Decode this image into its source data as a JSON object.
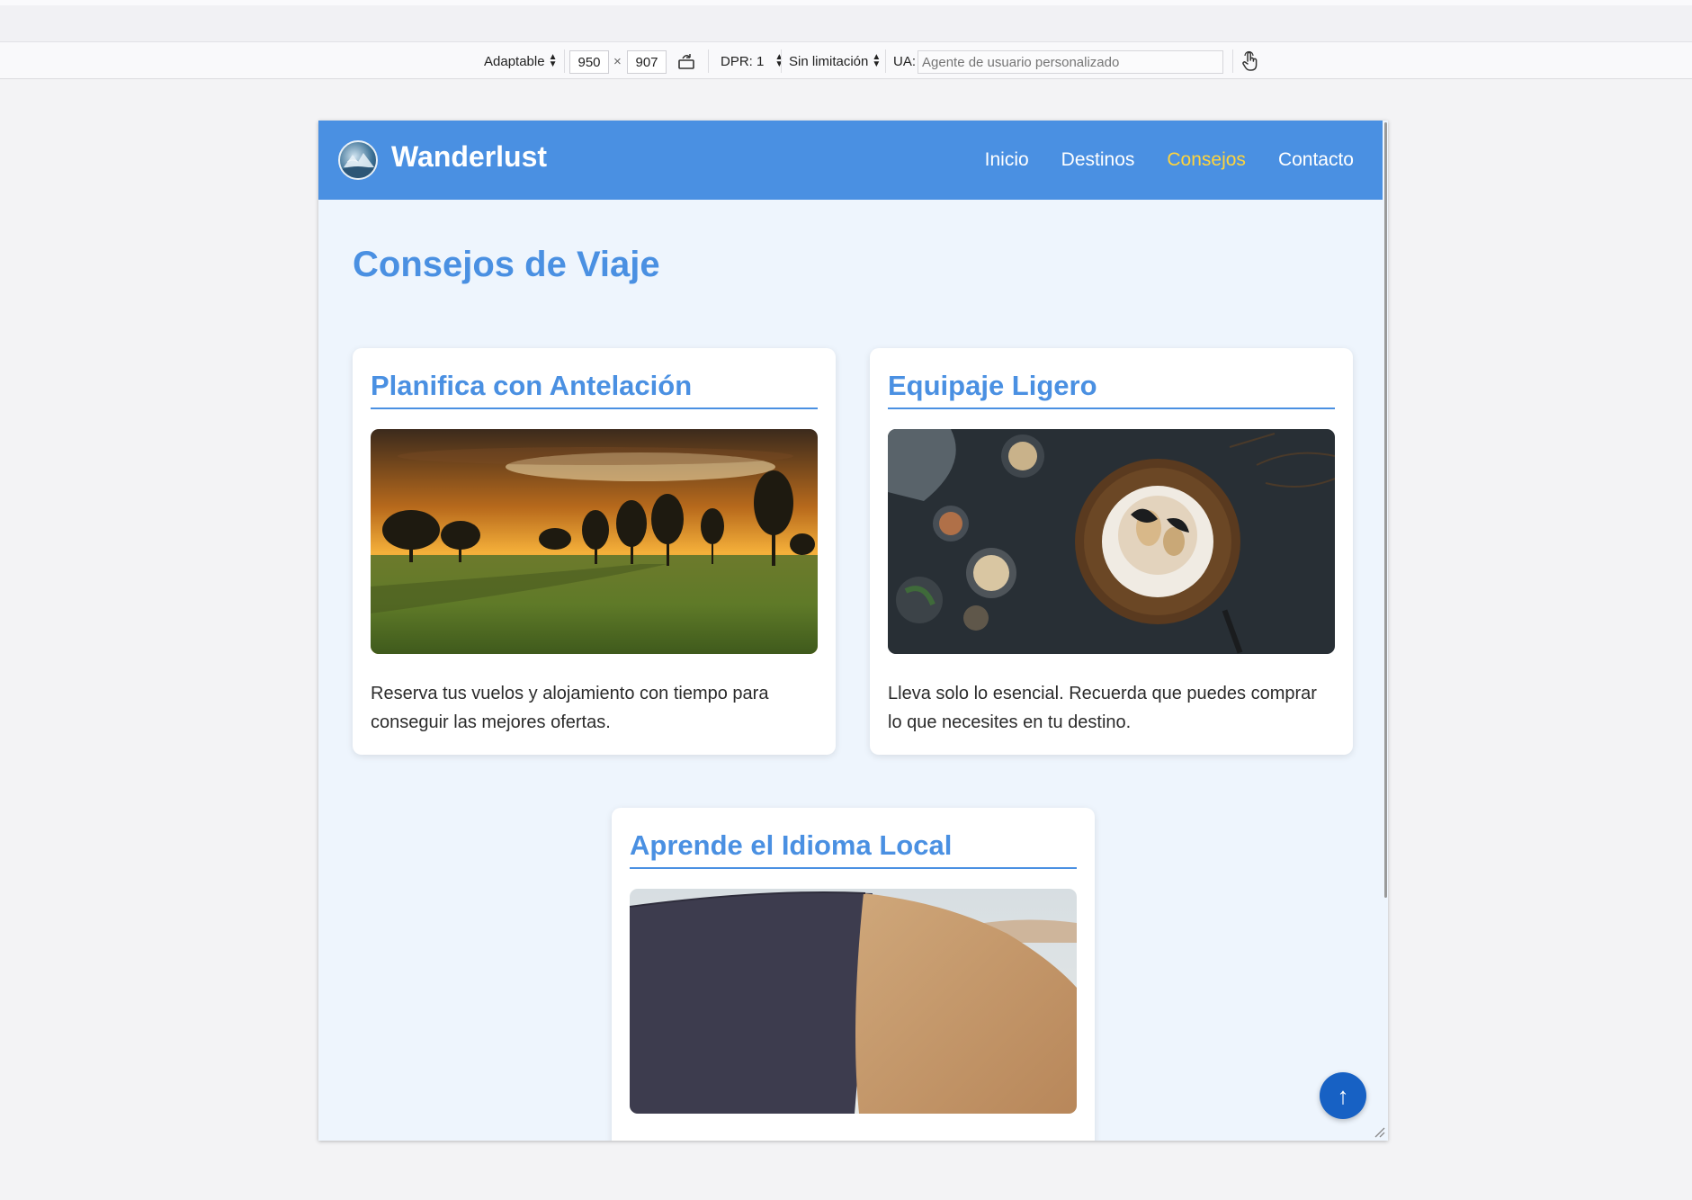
{
  "devtools": {
    "device": "Adaptable",
    "width": "950",
    "times": "×",
    "height": "907",
    "dpr": "DPR: 1",
    "throttle": "Sin limitación",
    "ua_label": "UA:",
    "ua_placeholder": "Agente de usuario personalizado"
  },
  "site": {
    "brand": "Wanderlust",
    "nav": [
      {
        "label": "Inicio",
        "active": false
      },
      {
        "label": "Destinos",
        "active": false
      },
      {
        "label": "Consejos",
        "active": true
      },
      {
        "label": "Contacto",
        "active": false
      }
    ],
    "page_title": "Consejos de Viaje",
    "cards": [
      {
        "title": "Planifica con Antelación",
        "text": "Reserva tus vuelos y alojamiento con tiempo para conseguir las mejores ofertas.",
        "image": "sunset-meadow-photo"
      },
      {
        "title": "Equipaje Ligero",
        "text": "Lleva solo lo esencial. Recuerda que puedes comprar lo que necesites en tu destino.",
        "image": "dessert-table-photo"
      },
      {
        "title": "Aprende el Idioma Local",
        "text": "",
        "image": "sand-dune-photo"
      }
    ],
    "back_to_top": "↑"
  },
  "colors": {
    "primary": "#4a90e2",
    "active_nav": "#ffd43b",
    "page_bg": "#eef5fd",
    "back_top": "#1761c4"
  }
}
